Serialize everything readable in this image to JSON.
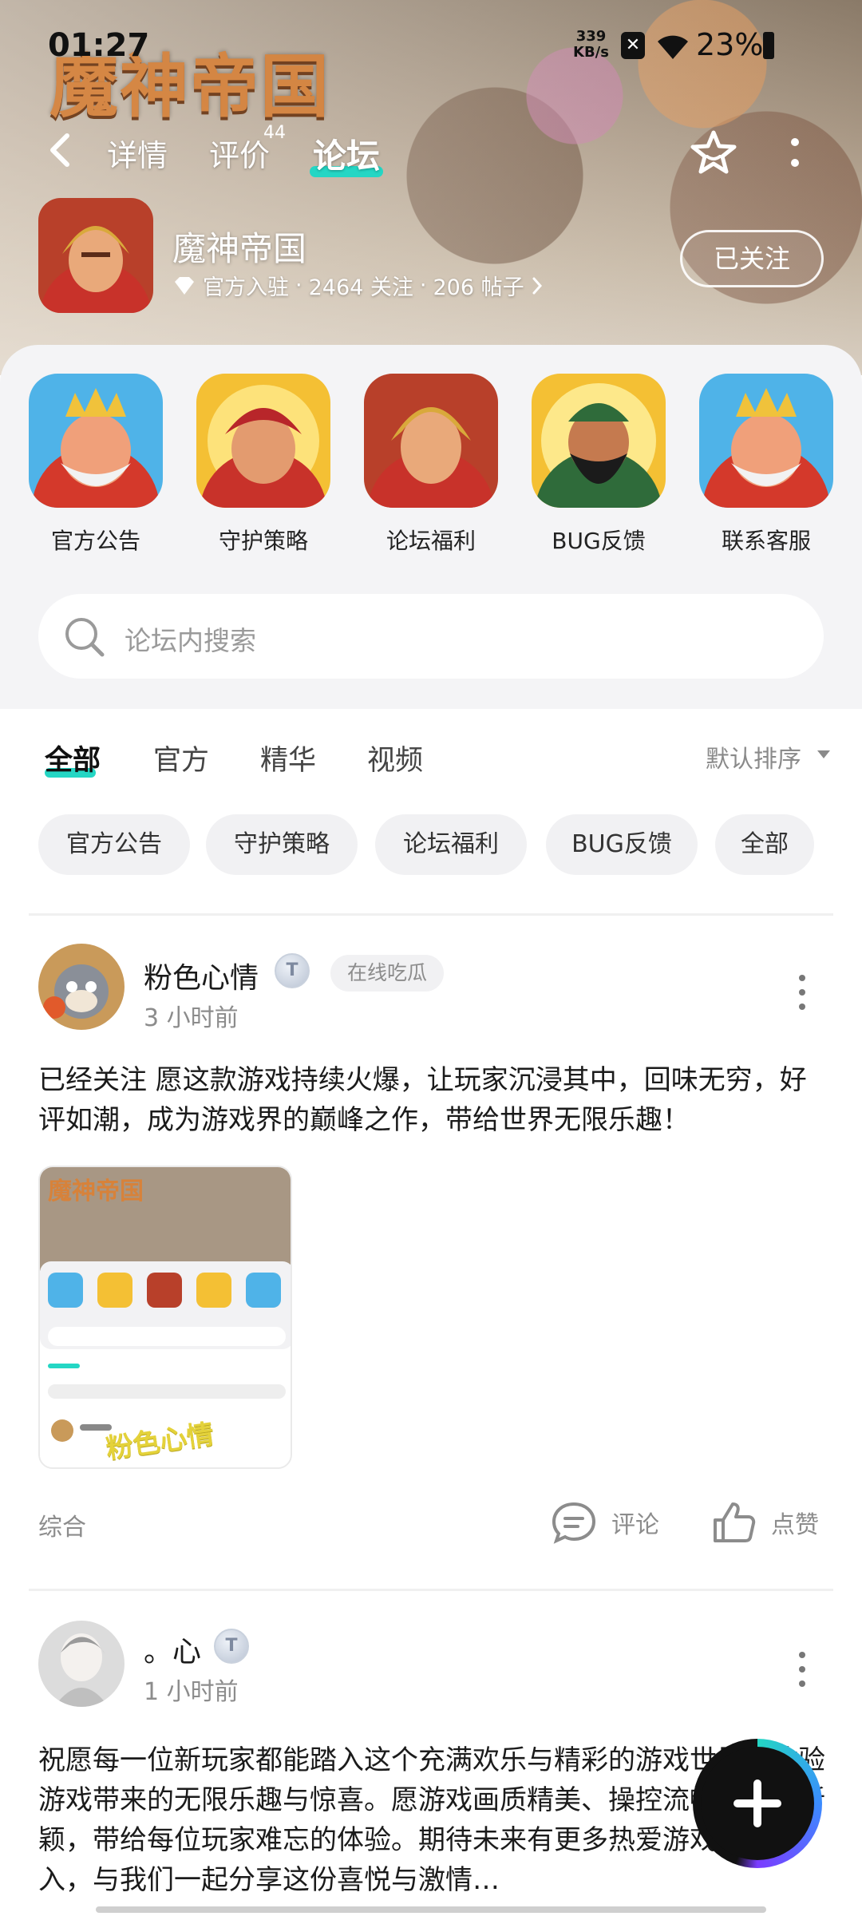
{
  "status_bar": {
    "time": "01:27",
    "net_speed_value": "339",
    "net_speed_unit": "KB/s",
    "battery": "23%"
  },
  "banner": {
    "logo_text": "魔神帝国"
  },
  "nav": {
    "tabs": [
      {
        "label": "详情"
      },
      {
        "label": "评价",
        "badge": "44"
      },
      {
        "label": "论坛",
        "active": true
      }
    ]
  },
  "game": {
    "name": "魔神帝国",
    "official": "官方入驻",
    "followers": "2464 关注",
    "posts": "206 帖子",
    "sep": "·",
    "follow_label": "已关注"
  },
  "shortcuts": [
    {
      "label": "官方公告",
      "icon": "king-avatar-icon"
    },
    {
      "label": "守护策略",
      "icon": "warrior-avatar-icon"
    },
    {
      "label": "论坛福利",
      "icon": "warrior-red-icon"
    },
    {
      "label": "BUG反馈",
      "icon": "bearded-general-icon"
    },
    {
      "label": "联系客服",
      "icon": "king-avatar-icon"
    }
  ],
  "search": {
    "placeholder": "论坛内搜索"
  },
  "filter_tabs": [
    {
      "label": "全部",
      "active": true
    },
    {
      "label": "官方"
    },
    {
      "label": "精华"
    },
    {
      "label": "视频"
    }
  ],
  "sort_label": "默认排序",
  "chips": [
    "官方公告",
    "守护策略",
    "论坛福利",
    "BUG反馈",
    "全部"
  ],
  "posts": [
    {
      "user": "粉色心情",
      "level": "T",
      "tag": "在线吃瓜",
      "time": "3 小时前",
      "text": "已经关注  愿这款游戏持续火爆，让玩家沉浸其中，回味无穷，好评如潮，成为游戏界的巅峰之作，带给世界无限乐趣！",
      "image_watermark": "粉色心情",
      "category": "综合",
      "comment_label": "评论",
      "like_label": "点赞"
    },
    {
      "user": "。心",
      "level": "T",
      "time": "1 小时前",
      "text": "祝愿每一位新玩家都能踏入这个充满欢乐与精彩的游戏世界，体验游戏带来的无限乐趣与惊喜。愿游戏画质精美、操控流畅、玩法新颖，带给每位玩家难忘的体验。期待未来有更多热爱游戏的人加入，与我们一起分享这份喜悦与激情…"
    }
  ],
  "colors": {
    "accent": "#24d6c4",
    "text_secondary": "#8c8c8c",
    "chip_bg": "#f1f1f3",
    "panel_bg": "#f4f4f6"
  }
}
